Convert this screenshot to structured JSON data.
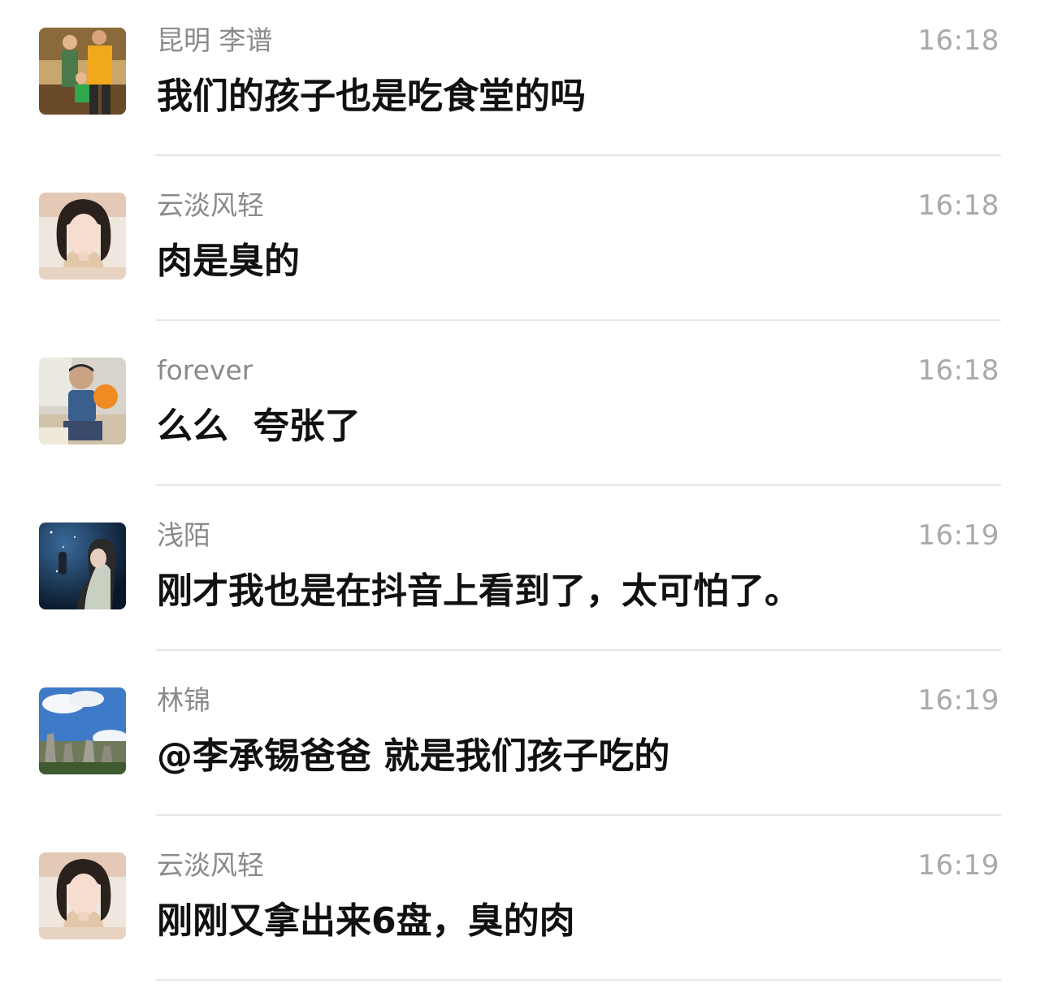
{
  "messages": [
    {
      "sender": "昆明 李谱",
      "time": "16:18",
      "text": "我们的孩子也是吃食堂的吗"
    },
    {
      "sender": "云淡风轻",
      "time": "16:18",
      "text": "肉是臭的"
    },
    {
      "sender": "forever",
      "time": "16:18",
      "text": "么么  夸张了"
    },
    {
      "sender": "浅陌",
      "time": "16:19",
      "text": "刚才我也是在抖音上看到了，太可怕了。"
    },
    {
      "sender": "林锦",
      "time": "16:19",
      "text": "@李承锡爸爸 就是我们孩子吃的"
    },
    {
      "sender": "云淡风轻",
      "time": "16:19",
      "text": "刚刚又拿出来6盘，臭的肉"
    }
  ]
}
